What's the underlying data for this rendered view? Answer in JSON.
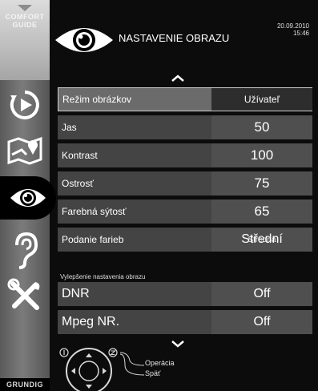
{
  "guide": {
    "line1": "COMFORT",
    "line2": "GUIDE",
    "brand": "GRUNDIG"
  },
  "sidebar": [
    {
      "icon": "play-icon",
      "active": false
    },
    {
      "icon": "map-icon",
      "active": false
    },
    {
      "icon": "eye-icon",
      "active": true
    },
    {
      "icon": "ear-icon",
      "active": false
    },
    {
      "icon": "tools-icon",
      "active": false
    }
  ],
  "header": {
    "title": "NASTAVENIE OBRAZU",
    "date": "20.09.2010",
    "time": "15:46"
  },
  "menu": [
    {
      "label": "Režim obrázkov",
      "value": "Užívateľ",
      "selected": true
    },
    {
      "label": "Jas",
      "value": "50"
    },
    {
      "label": "Kontrast",
      "value": "100"
    },
    {
      "label": "Ostrosť",
      "value": "75"
    },
    {
      "label": "Farebná sýtosť",
      "value": "65"
    },
    {
      "label": "Podanie farieb",
      "value": "Střední",
      "value_overlay": "Stredná"
    }
  ],
  "section_title": "Vylepšenie nastavenia obrazu",
  "enhance": [
    {
      "label": "DNR",
      "value": "Off"
    },
    {
      "label": "Mpeg NR.",
      "value": "Off"
    }
  ],
  "hints": {
    "ok": "Operácia",
    "back": "Späť"
  }
}
